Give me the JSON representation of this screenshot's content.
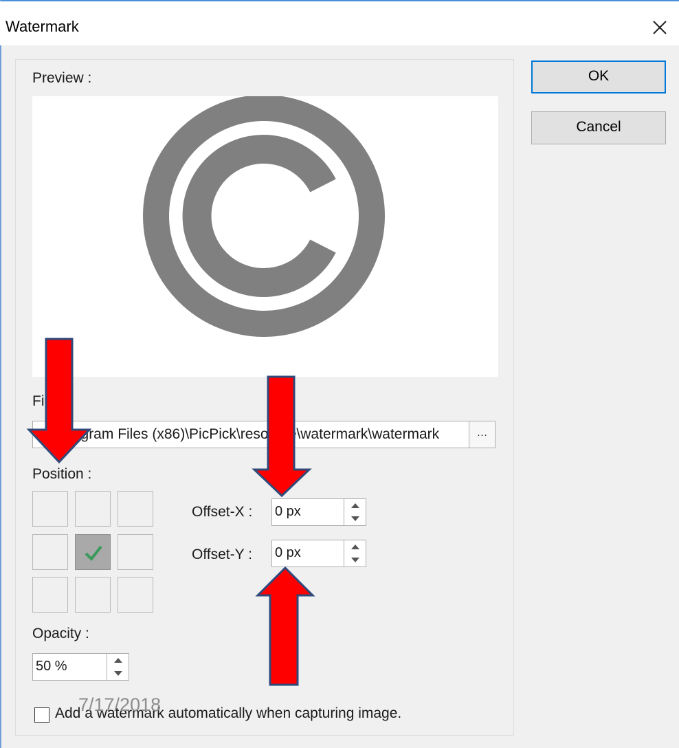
{
  "dialog": {
    "title": "Watermark"
  },
  "buttons": {
    "ok": "OK",
    "cancel": "Cancel"
  },
  "preview": {
    "label": "Preview :",
    "image_icon": "copyright-icon",
    "image_color": "#808080"
  },
  "file": {
    "label": "File",
    "path": "C:\\Program Files (x86)\\PicPick\\resource\\watermark\\watermark",
    "browse_label": "…"
  },
  "position": {
    "label": "Position :",
    "grid": [
      [
        "",
        "",
        ""
      ],
      [
        "",
        "selected",
        ""
      ],
      [
        "",
        "",
        ""
      ]
    ],
    "selected_icon": "check-icon",
    "check_color": "#3a9a5b"
  },
  "offset_x": {
    "label": "Offset-X :",
    "value": "0 px"
  },
  "offset_y": {
    "label": "Offset-Y :",
    "value": "0 px"
  },
  "opacity": {
    "label": "Opacity :",
    "value": "50 %"
  },
  "auto_watermark": {
    "label": "Add a watermark automatically when capturing image.",
    "checked": false
  },
  "annotation": {
    "date": "7/17/2018",
    "arrow_color": "#ff0000",
    "arrow_outline": "#2f4a7a"
  },
  "colors": {
    "accent": "#0078d7",
    "window_bg": "#f0f0f0"
  }
}
